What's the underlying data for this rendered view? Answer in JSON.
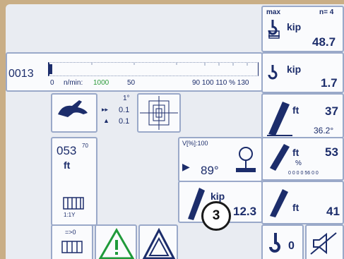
{
  "top_right": {
    "max_label": "max",
    "n_label": "n= 4",
    "unit": "kip",
    "value": "48.7"
  },
  "load_line": {
    "value": "0013",
    "scale_left": "0",
    "speed_label": "n/min:",
    "speed_value": "1000",
    "scale_50": "50",
    "scale_right": "90 100 110 % 130"
  },
  "current_load": {
    "unit": "kip",
    "value": "1.7"
  },
  "boom_length": {
    "unit": "ft",
    "value": "37",
    "angle": "36.2°"
  },
  "boom_angle": {
    "unit": "ft",
    "sub_unit": "%",
    "value": "53",
    "scale": "0 0 0 0 56 0 0"
  },
  "height": {
    "unit": "ft",
    "value": "41"
  },
  "speed_panel": {
    "val1": "1°",
    "val2": "0.1",
    "val3": "0.1"
  },
  "counter_panel": {
    "value": "053",
    "superscript": "70",
    "unit": "ft",
    "ratio": "1:1Y"
  },
  "slew_panel": {
    "header": "V[%]:100",
    "angle": "89°"
  },
  "jib_panel": {
    "unit": "kip",
    "value": "12.3"
  },
  "bottom": {
    "hook_value": "0",
    "reeving_label": "=>0"
  },
  "callout": {
    "number": "3"
  },
  "colors": {
    "accent": "#1c2d6b",
    "warning": "#1f9a3a",
    "panel_border": "#9aa9c9"
  }
}
